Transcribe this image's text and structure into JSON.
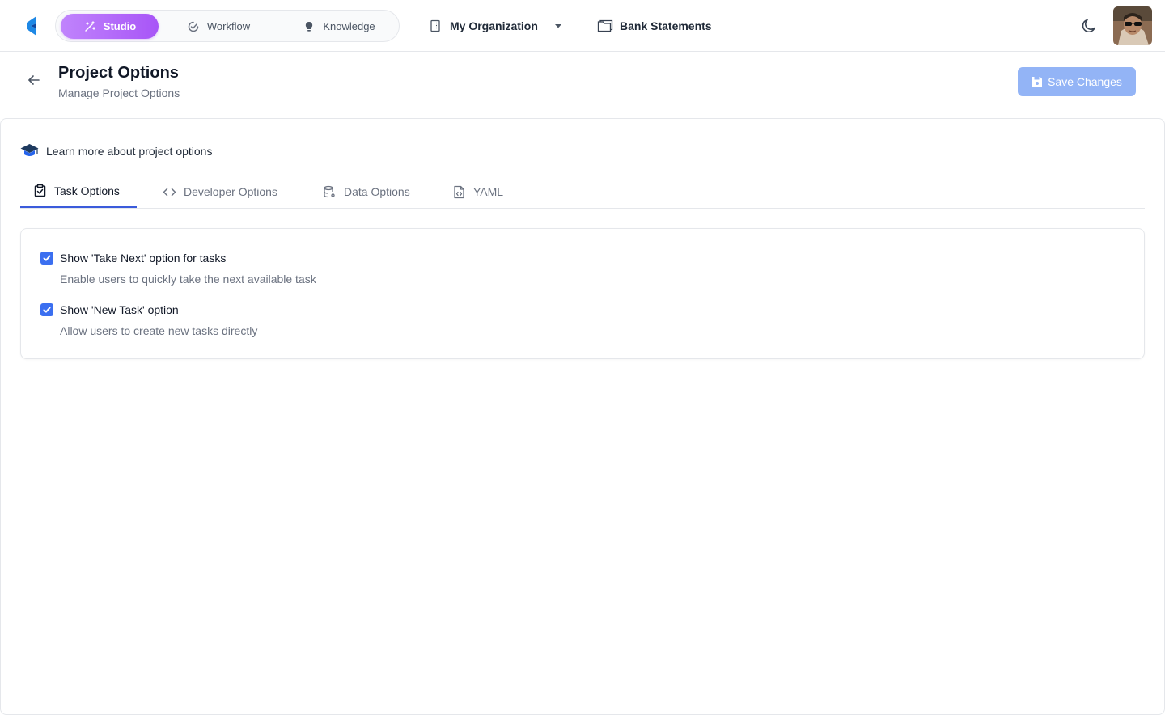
{
  "topbar": {
    "modes": [
      {
        "label": "Studio",
        "icon": "magic-wand-icon",
        "active": true
      },
      {
        "label": "Workflow",
        "icon": "check-progress-icon",
        "active": false
      },
      {
        "label": "Knowledge",
        "icon": "lightbulb-icon",
        "active": false
      }
    ],
    "organization": "My Organization",
    "project": "Bank Statements",
    "theme_icon": "moon-icon"
  },
  "header": {
    "title": "Project Options",
    "subtitle": "Manage Project Options",
    "save_label": "Save Changes"
  },
  "learn_more": "Learn more about project options",
  "tabs": [
    {
      "label": "Task Options",
      "icon": "clipboard-check-icon",
      "active": true
    },
    {
      "label": "Developer Options",
      "icon": "code-icon",
      "active": false
    },
    {
      "label": "Data Options",
      "icon": "database-gear-icon",
      "active": false
    },
    {
      "label": "YAML",
      "icon": "file-code-icon",
      "active": false
    }
  ],
  "options": [
    {
      "label": "Show 'Take Next' option for tasks",
      "description": "Enable users to quickly take the next available task",
      "checked": true
    },
    {
      "label": "Show 'New Task' option",
      "description": "Allow users to create new tasks directly",
      "checked": true
    }
  ],
  "colors": {
    "accent_purple": "#a855f7",
    "primary_blue": "#3b6ff0",
    "save_disabled": "#93b4f6",
    "logo_blue": "#1e88e5"
  }
}
